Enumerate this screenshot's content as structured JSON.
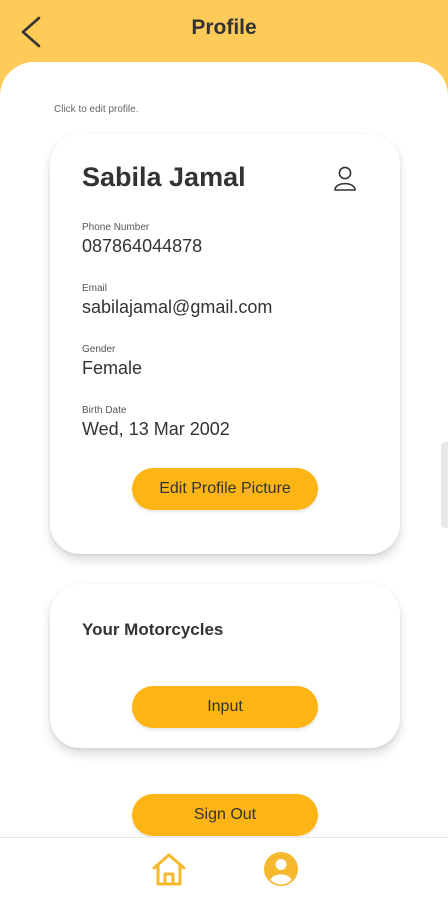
{
  "header": {
    "title": "Profile"
  },
  "hint": "Click to edit profile.",
  "profile": {
    "name": "Sabila Jamal",
    "fields": [
      {
        "label": "Phone Number",
        "value": "087864044878"
      },
      {
        "label": "Email",
        "value": "sabilajamal@gmail.com"
      },
      {
        "label": "Gender",
        "value": "Female"
      },
      {
        "label": "Birth Date",
        "value": "Wed, 13 Mar 2002"
      }
    ],
    "edit_picture_label": "Edit Profile Picture"
  },
  "motorcycles": {
    "title": "Your Motorcycles",
    "input_label": "Input"
  },
  "sign_out_label": "Sign Out",
  "nav": {
    "items": [
      {
        "icon": "home-icon"
      },
      {
        "icon": "account-circle-icon"
      }
    ]
  },
  "colors": {
    "header_bg": "#fecb59",
    "button_bg": "#fdb515",
    "nav_icon": "#f5b82e"
  }
}
